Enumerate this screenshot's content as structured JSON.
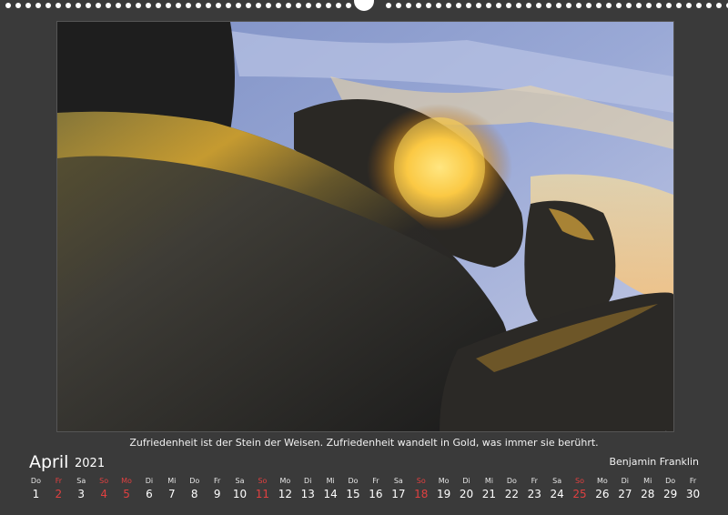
{
  "quote": "Zufriedenheit ist der Stein der Weisen. Zufriedenheit wandelt in Gold, was immer sie berührt.",
  "author": "Benjamin Franklin",
  "month": "April",
  "year": "2021",
  "colors": {
    "background": "#3a3a3a",
    "text": "#ffffff",
    "holiday": "#e04040"
  },
  "days": [
    {
      "wd": "Do",
      "dn": "1",
      "red": false
    },
    {
      "wd": "Fr",
      "dn": "2",
      "red": true
    },
    {
      "wd": "Sa",
      "dn": "3",
      "red": false
    },
    {
      "wd": "So",
      "dn": "4",
      "red": true
    },
    {
      "wd": "Mo",
      "dn": "5",
      "red": true
    },
    {
      "wd": "Di",
      "dn": "6",
      "red": false
    },
    {
      "wd": "Mi",
      "dn": "7",
      "red": false
    },
    {
      "wd": "Do",
      "dn": "8",
      "red": false
    },
    {
      "wd": "Fr",
      "dn": "9",
      "red": false
    },
    {
      "wd": "Sa",
      "dn": "10",
      "red": false
    },
    {
      "wd": "So",
      "dn": "11",
      "red": true
    },
    {
      "wd": "Mo",
      "dn": "12",
      "red": false
    },
    {
      "wd": "Di",
      "dn": "13",
      "red": false
    },
    {
      "wd": "Mi",
      "dn": "14",
      "red": false
    },
    {
      "wd": "Do",
      "dn": "15",
      "red": false
    },
    {
      "wd": "Fr",
      "dn": "16",
      "red": false
    },
    {
      "wd": "Sa",
      "dn": "17",
      "red": false
    },
    {
      "wd": "So",
      "dn": "18",
      "red": true
    },
    {
      "wd": "Mo",
      "dn": "19",
      "red": false
    },
    {
      "wd": "Di",
      "dn": "20",
      "red": false
    },
    {
      "wd": "Mi",
      "dn": "21",
      "red": false
    },
    {
      "wd": "Do",
      "dn": "22",
      "red": false
    },
    {
      "wd": "Fr",
      "dn": "23",
      "red": false
    },
    {
      "wd": "Sa",
      "dn": "24",
      "red": false
    },
    {
      "wd": "So",
      "dn": "25",
      "red": true
    },
    {
      "wd": "Mo",
      "dn": "26",
      "red": false
    },
    {
      "wd": "Di",
      "dn": "27",
      "red": false
    },
    {
      "wd": "Mi",
      "dn": "28",
      "red": false
    },
    {
      "wd": "Do",
      "dn": "29",
      "red": false
    },
    {
      "wd": "Fr",
      "dn": "30",
      "red": false
    }
  ]
}
